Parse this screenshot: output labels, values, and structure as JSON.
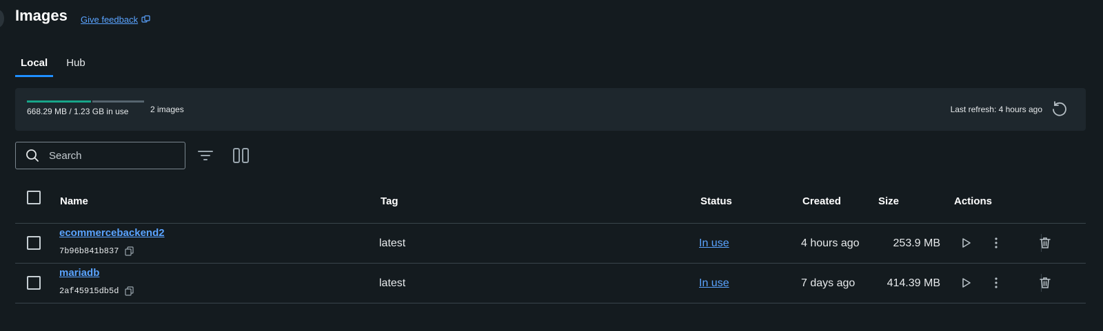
{
  "page": {
    "title": "Images",
    "feedback_label": "Give feedback"
  },
  "tabs": [
    {
      "label": "Local",
      "active": true
    },
    {
      "label": "Hub",
      "active": false
    }
  ],
  "summary": {
    "usage_text": "668.29 MB / 1.23 GB in use",
    "usage_fraction": 0.53,
    "images_count": "2 images",
    "last_refresh": "Last refresh: 4 hours ago"
  },
  "search": {
    "placeholder": "Search",
    "value": ""
  },
  "table": {
    "headers": {
      "name": "Name",
      "tag": "Tag",
      "status": "Status",
      "created": "Created",
      "size": "Size",
      "actions": "Actions"
    },
    "rows": [
      {
        "name": "ecommercebackend2",
        "id": "7b96b841b837",
        "tag": "latest",
        "status": "In use",
        "created": "4 hours ago",
        "size": "253.9 MB"
      },
      {
        "name": "mariadb",
        "id": "2af45915db5d",
        "tag": "latest",
        "status": "In use",
        "created": "7 days ago",
        "size": "414.39 MB"
      }
    ]
  },
  "colors": {
    "accent": "#1f8fff",
    "link": "#5aa3ff",
    "usage_bar": "#18a68a",
    "background": "#141b1f",
    "panel": "#1e272d"
  },
  "icons": [
    "feedback-external-icon",
    "refresh-icon",
    "search-icon",
    "filter-icon",
    "columns-icon",
    "copy-icon",
    "play-icon",
    "more-vertical-icon",
    "trash-icon"
  ]
}
